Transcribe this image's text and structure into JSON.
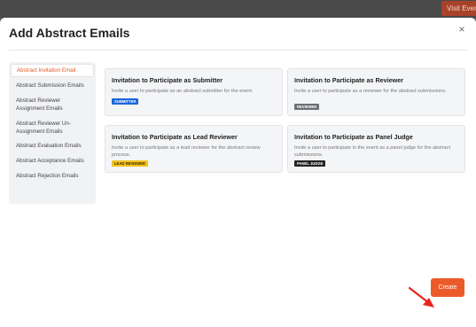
{
  "header": {
    "visit_event_label": "Visit Event"
  },
  "modal": {
    "title": "Add Abstract Emails",
    "close_label": "×",
    "create_label": "Create"
  },
  "sidebar": {
    "items": [
      {
        "label": "Abstract Invitation Email",
        "active": true
      },
      {
        "label": "Abstract Submission Emails"
      },
      {
        "label": "Abstract Reviewer Assignment Emails"
      },
      {
        "label": "Abstract Reviewer Un-Assignment Emails"
      },
      {
        "label": "Abstract Evaluation Emails"
      },
      {
        "label": "Abstract Acceptance Emails"
      },
      {
        "label": "Abstract Rejection Emails"
      }
    ]
  },
  "cards": [
    {
      "title": "Invitation to Participate as Submitter",
      "description": "Invite a user to participate as an abstract submitter for the event.",
      "badge": "SUBMITTER",
      "badge_color": "#1a66d9",
      "badge_text_color": "#ffffff"
    },
    {
      "title": "Invitation to Participate as Reviewer",
      "description": "Invite a user to participate as a reviewer for the abstract submissions.",
      "badge": "REVIEWER",
      "badge_color": "#6b6f75",
      "badge_text_color": "#ffffff"
    },
    {
      "title": "Invitation to Participate as Lead Reviewer",
      "description": "Invite a user to participate as a lead reviewer for the abstract review process.",
      "badge": "LEAD REVIEWER",
      "badge_color": "#f3c21b",
      "badge_text_color": "#3a2d00"
    },
    {
      "title": "Invitation to Participate as Panel Judge",
      "description": "Invite a user to participate in the event as a panel judge for the abstract submissions.",
      "badge": "PANEL JUDGE",
      "badge_color": "#222222",
      "badge_text_color": "#ffffff"
    }
  ],
  "colors": {
    "accent": "#ec5a2a",
    "arrow": "#e8241d"
  }
}
